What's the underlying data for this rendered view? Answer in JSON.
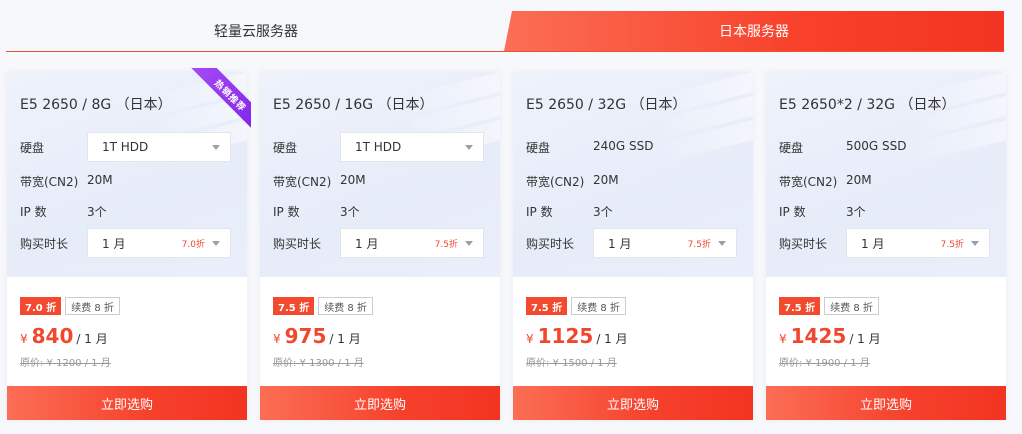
{
  "tabs": [
    {
      "label": "轻量云服务器",
      "active": false
    },
    {
      "label": "日本服务器",
      "active": true
    }
  ],
  "labels": {
    "disk": "硬盘",
    "bandwidth": "带宽(CN2)",
    "ip": "IP 数",
    "duration": "购买时长",
    "buy": "立即选购"
  },
  "colors": {
    "accent": "#f2492f",
    "ribbon": "#8a2ee8",
    "card_top_bg": "#eef2fb"
  },
  "cards": [
    {
      "title": "E5 2650 / 8G （日本）",
      "ribbon": "热销推荐",
      "disk": "1T HDD",
      "disk_is_select": true,
      "bandwidth": "20M",
      "ip": "3个",
      "duration": "1 月",
      "duration_discount": "7.0折",
      "badge_discount": "7.0 折",
      "badge_renew": "续费 8 折",
      "currency": "¥",
      "price": "840",
      "price_unit": "/ 1 月",
      "original": "原价: ¥ 1200 / 1 月"
    },
    {
      "title": "E5 2650 / 16G （日本）",
      "ribbon": "",
      "disk": "1T HDD",
      "disk_is_select": true,
      "bandwidth": "20M",
      "ip": "3个",
      "duration": "1 月",
      "duration_discount": "7.5折",
      "badge_discount": "7.5 折",
      "badge_renew": "续费 8 折",
      "currency": "¥",
      "price": "975",
      "price_unit": "/ 1 月",
      "original": "原价: ¥ 1300 / 1 月"
    },
    {
      "title": "E5 2650 / 32G （日本）",
      "ribbon": "",
      "disk": "240G SSD",
      "disk_is_select": false,
      "bandwidth": "20M",
      "ip": "3个",
      "duration": "1 月",
      "duration_discount": "7.5折",
      "badge_discount": "7.5 折",
      "badge_renew": "续费 8 折",
      "currency": "¥",
      "price": "1125",
      "price_unit": "/ 1 月",
      "original": "原价: ¥ 1500 / 1 月"
    },
    {
      "title": "E5 2650*2 / 32G （日本）",
      "ribbon": "",
      "disk": "500G SSD",
      "disk_is_select": false,
      "bandwidth": "20M",
      "ip": "3个",
      "duration": "1 月",
      "duration_discount": "7.5折",
      "badge_discount": "7.5 折",
      "badge_renew": "续费 8 折",
      "currency": "¥",
      "price": "1425",
      "price_unit": "/ 1 月",
      "original": "原价: ¥ 1900 / 1 月"
    }
  ]
}
